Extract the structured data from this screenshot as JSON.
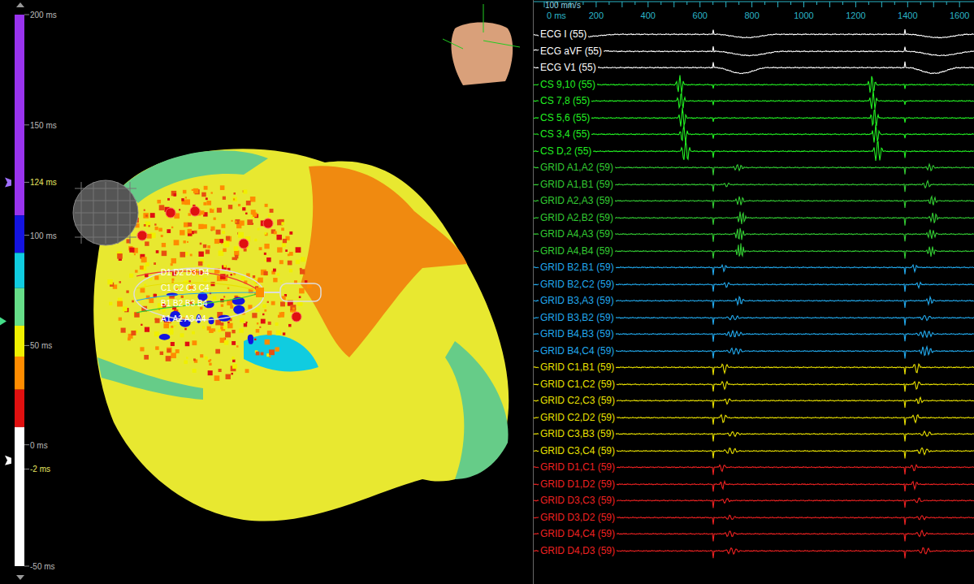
{
  "scale": {
    "labels": [
      {
        "text": "200 ms",
        "ms": 200,
        "highlight": false
      },
      {
        "text": "150 ms",
        "ms": 150,
        "highlight": false
      },
      {
        "text": "124 ms",
        "ms": 124,
        "highlight": true
      },
      {
        "text": "100 ms",
        "ms": 100,
        "highlight": false
      },
      {
        "text": "50 ms",
        "ms": 50,
        "highlight": false
      },
      {
        "text": "0 ms",
        "ms": 5,
        "highlight": false
      },
      {
        "text": "-2 ms",
        "ms": -6,
        "highlight": true
      },
      {
        "text": "-50 ms",
        "ms": -50,
        "highlight": false
      }
    ],
    "segments": [
      {
        "from_ms": 200,
        "to_ms": 109,
        "color": "#9933ee"
      },
      {
        "from_ms": 109,
        "to_ms": 92,
        "color": "#1414e0"
      },
      {
        "from_ms": 92,
        "to_ms": 76,
        "color": "#10cce0"
      },
      {
        "from_ms": 76,
        "to_ms": 59,
        "color": "#66dd88"
      },
      {
        "from_ms": 59,
        "to_ms": 45,
        "color": "#f0f000"
      },
      {
        "from_ms": 45,
        "to_ms": 30,
        "color": "#ff8c00"
      },
      {
        "from_ms": 30,
        "to_ms": 13,
        "color": "#e01010"
      },
      {
        "from_ms": 13,
        "to_ms": -50,
        "color": "#ffffff"
      }
    ],
    "markers": [
      {
        "ms": 124,
        "color": "#a070ff"
      },
      {
        "ms": 61,
        "color": "#44dd88"
      },
      {
        "ms": -2,
        "color": "#ffffff"
      }
    ]
  },
  "map": {
    "catheter_labels": [
      "D1 D2 D3 D4",
      "C1 C2 C3 C4",
      "B1 B2 B3 B4",
      "A1 A2 A3 A4"
    ]
  },
  "trace_panel": {
    "speed": "100 mm/s",
    "ticks": [
      "0 ms",
      "200",
      "400",
      "600",
      "800",
      "1000",
      "1200",
      "1400",
      "1600"
    ],
    "stimulus_ms": [
      650,
      1390
    ],
    "channels": [
      {
        "name": "ECG I (55)",
        "color": "#ffffff",
        "stim_amp": 6,
        "deflections": [
          {
            "t": -100,
            "amp": -4,
            "dur": 400,
            "cycles": 0.5
          },
          {
            "t": 660,
            "amp": -4,
            "dur": 240,
            "cycles": 0.5
          },
          {
            "t": 1400,
            "amp": -4,
            "dur": 240,
            "cycles": 0.5
          }
        ]
      },
      {
        "name": "ECG aVF (55)",
        "color": "#ffffff",
        "stim_amp": 6,
        "deflections": [
          {
            "t": -150,
            "amp": 3,
            "dur": 450,
            "cycles": 0.5
          },
          {
            "t": 660,
            "amp": -5,
            "dur": 260,
            "cycles": 0.5
          },
          {
            "t": 1400,
            "amp": -5,
            "dur": 260,
            "cycles": 0.5
          }
        ]
      },
      {
        "name": "ECG V1 (55)",
        "color": "#ffffff",
        "stim_amp": 7,
        "deflections": [
          {
            "t": 660,
            "amp": -7,
            "dur": 200,
            "cycles": 0.5
          },
          {
            "t": 1400,
            "amp": -7,
            "dur": 200,
            "cycles": 0.5
          }
        ]
      },
      {
        "name": "CS 9,10 (55)",
        "color": "#22ee22",
        "stim_amp": -5,
        "deflections": [
          {
            "t": 505,
            "amp": 12,
            "dur": 35,
            "cycles": 2.5
          },
          {
            "t": 1245,
            "amp": 12,
            "dur": 35,
            "cycles": 2.5
          }
        ]
      },
      {
        "name": "CS 7,8 (55)",
        "color": "#22ee22",
        "stim_amp": -5,
        "deflections": [
          {
            "t": 510,
            "amp": 12,
            "dur": 35,
            "cycles": 2.5
          },
          {
            "t": 1250,
            "amp": 12,
            "dur": 35,
            "cycles": 2.5
          }
        ]
      },
      {
        "name": "CS 5,6 (55)",
        "color": "#22ee22",
        "stim_amp": -5,
        "deflections": [
          {
            "t": 515,
            "amp": 13,
            "dur": 35,
            "cycles": 2.5
          },
          {
            "t": 1255,
            "amp": 13,
            "dur": 35,
            "cycles": 2.5
          }
        ]
      },
      {
        "name": "CS 3,4 (55)",
        "color": "#22ee22",
        "stim_amp": -5,
        "deflections": [
          {
            "t": 520,
            "amp": 12,
            "dur": 35,
            "cycles": 2.5
          },
          {
            "t": 1260,
            "amp": 12,
            "dur": 35,
            "cycles": 2.5
          }
        ]
      },
      {
        "name": "CS D,2 (55)",
        "color": "#22ee22",
        "stim_amp": -8,
        "deflections": [
          {
            "t": 525,
            "amp": 14,
            "dur": 40,
            "cycles": 2.5
          },
          {
            "t": 1265,
            "amp": 14,
            "dur": 40,
            "cycles": 2.5
          }
        ]
      },
      {
        "name": "GRID A1,A2 (59)",
        "color": "#33cc33",
        "stim_amp": -9,
        "deflections": [
          {
            "t": 725,
            "amp": 4,
            "dur": 45,
            "cycles": 3
          },
          {
            "t": 1465,
            "amp": 4,
            "dur": 45,
            "cycles": 3
          }
        ]
      },
      {
        "name": "GRID A1,B1 (59)",
        "color": "#33cc33",
        "stim_amp": -9,
        "deflections": [
          {
            "t": 690,
            "amp": 3,
            "dur": 25,
            "cycles": 1.5
          },
          {
            "t": 1455,
            "amp": 5,
            "dur": 35,
            "cycles": 2
          }
        ]
      },
      {
        "name": "GRID A2,A3 (59)",
        "color": "#33cc33",
        "stim_amp": -9,
        "deflections": [
          {
            "t": 735,
            "amp": 6,
            "dur": 40,
            "cycles": 3
          },
          {
            "t": 1475,
            "amp": 6,
            "dur": 40,
            "cycles": 3
          }
        ]
      },
      {
        "name": "GRID A2,B2 (59)",
        "color": "#33cc33",
        "stim_amp": -9,
        "deflections": [
          {
            "t": 740,
            "amp": 8,
            "dur": 40,
            "cycles": 3.5
          },
          {
            "t": 1480,
            "amp": 7,
            "dur": 40,
            "cycles": 3
          }
        ]
      },
      {
        "name": "GRID A4,A3 (59)",
        "color": "#33cc33",
        "stim_amp": -9,
        "deflections": [
          {
            "t": 730,
            "amp": 9,
            "dur": 45,
            "cycles": 4
          },
          {
            "t": 1470,
            "amp": 6,
            "dur": 45,
            "cycles": 3.5
          }
        ]
      },
      {
        "name": "GRID A4,B4 (59)",
        "color": "#33cc33",
        "stim_amp": -9,
        "deflections": [
          {
            "t": 735,
            "amp": 10,
            "dur": 40,
            "cycles": 4
          },
          {
            "t": 1470,
            "amp": 7,
            "dur": 40,
            "cycles": 3.5
          }
        ]
      },
      {
        "name": "GRID B2,B1 (59)",
        "color": "#22aaee",
        "stim_amp": -9,
        "deflections": [
          {
            "t": 680,
            "amp": 5,
            "dur": 25,
            "cycles": 1.5
          },
          {
            "t": 1415,
            "amp": 5,
            "dur": 25,
            "cycles": 1.5
          }
        ]
      },
      {
        "name": "GRID B2,C2 (59)",
        "color": "#22aaee",
        "stim_amp": -9,
        "deflections": [
          {
            "t": 690,
            "amp": 4,
            "dur": 25,
            "cycles": 1.5
          },
          {
            "t": 1430,
            "amp": 4,
            "dur": 25,
            "cycles": 1.5
          }
        ]
      },
      {
        "name": "GRID B3,A3 (59)",
        "color": "#22aaee",
        "stim_amp": -9,
        "deflections": [
          {
            "t": 735,
            "amp": 6,
            "dur": 35,
            "cycles": 2.5
          },
          {
            "t": 1470,
            "amp": 5,
            "dur": 35,
            "cycles": 2.5
          }
        ]
      },
      {
        "name": "GRID B3,B2 (59)",
        "color": "#22aaee",
        "stim_amp": -9,
        "deflections": [
          {
            "t": 700,
            "amp": 3,
            "dur": 60,
            "cycles": 3
          },
          {
            "t": 1440,
            "amp": 3,
            "dur": 60,
            "cycles": 3
          }
        ]
      },
      {
        "name": "GRID B4,B3 (59)",
        "color": "#22aaee",
        "stim_amp": -9,
        "deflections": [
          {
            "t": 690,
            "amp": 4,
            "dur": 80,
            "cycles": 5
          },
          {
            "t": 1430,
            "amp": 4,
            "dur": 80,
            "cycles": 5
          }
        ]
      },
      {
        "name": "GRID B4,C4 (59)",
        "color": "#22aaee",
        "stim_amp": -9,
        "deflections": [
          {
            "t": 700,
            "amp": 4,
            "dur": 70,
            "cycles": 4
          },
          {
            "t": 1440,
            "amp": 6,
            "dur": 60,
            "cycles": 4
          }
        ]
      },
      {
        "name": "GRID C1,B1 (59)",
        "color": "#e8e000",
        "stim_amp": -9,
        "deflections": [
          {
            "t": 680,
            "amp": 7,
            "dur": 30,
            "cycles": 1.5
          },
          {
            "t": 1420,
            "amp": 7,
            "dur": 30,
            "cycles": 1.5
          }
        ]
      },
      {
        "name": "GRID C1,C2 (59)",
        "color": "#e8e000",
        "stim_amp": -9,
        "deflections": [
          {
            "t": 680,
            "amp": 6,
            "dur": 30,
            "cycles": 1.5
          },
          {
            "t": 1420,
            "amp": 6,
            "dur": 30,
            "cycles": 1.5
          }
        ]
      },
      {
        "name": "GRID C2,C3 (59)",
        "color": "#e8e000",
        "stim_amp": -9,
        "deflections": [
          {
            "t": 690,
            "amp": 4,
            "dur": 30,
            "cycles": 1.5
          },
          {
            "t": 1430,
            "amp": 5,
            "dur": 30,
            "cycles": 2
          }
        ]
      },
      {
        "name": "GRID C2,D2 (59)",
        "color": "#e8e000",
        "stim_amp": -9,
        "deflections": [
          {
            "t": 675,
            "amp": 6,
            "dur": 30,
            "cycles": 1.5
          },
          {
            "t": 1415,
            "amp": 6,
            "dur": 30,
            "cycles": 1.5
          }
        ]
      },
      {
        "name": "GRID C3,B3 (59)",
        "color": "#e8e000",
        "stim_amp": -9,
        "deflections": [
          {
            "t": 700,
            "amp": 3,
            "dur": 60,
            "cycles": 3
          },
          {
            "t": 1440,
            "amp": 3,
            "dur": 60,
            "cycles": 3
          }
        ]
      },
      {
        "name": "GRID C3,C4 (59)",
        "color": "#e8e000",
        "stim_amp": -9,
        "deflections": [
          {
            "t": 690,
            "amp": 4,
            "dur": 60,
            "cycles": 3
          },
          {
            "t": 1430,
            "amp": 4,
            "dur": 60,
            "cycles": 3
          }
        ]
      },
      {
        "name": "GRID D1,C1 (59)",
        "color": "#ee2222",
        "stim_amp": -9,
        "deflections": [
          {
            "t": 670,
            "amp": 5,
            "dur": 30,
            "cycles": 1.5
          },
          {
            "t": 1410,
            "amp": 5,
            "dur": 30,
            "cycles": 1.5
          }
        ]
      },
      {
        "name": "GRID D1,D2 (59)",
        "color": "#ee2222",
        "stim_amp": -9,
        "deflections": [
          {
            "t": 675,
            "amp": 6,
            "dur": 25,
            "cycles": 1.5
          },
          {
            "t": 1415,
            "amp": 6,
            "dur": 25,
            "cycles": 1.5
          }
        ]
      },
      {
        "name": "GRID D3,C3 (59)",
        "color": "#ee2222",
        "stim_amp": -9,
        "deflections": [
          {
            "t": 680,
            "amp": 3,
            "dur": 40,
            "cycles": 2
          },
          {
            "t": 1420,
            "amp": 3,
            "dur": 40,
            "cycles": 2
          }
        ]
      },
      {
        "name": "GRID D3,D2 (59)",
        "color": "#ee2222",
        "stim_amp": -9,
        "deflections": [
          {
            "t": 690,
            "amp": 3,
            "dur": 50,
            "cycles": 2.5
          },
          {
            "t": 1430,
            "amp": 3,
            "dur": 50,
            "cycles": 2.5
          }
        ]
      },
      {
        "name": "GRID D4,C4 (59)",
        "color": "#ee2222",
        "stim_amp": -9,
        "deflections": [
          {
            "t": 690,
            "amp": 4,
            "dur": 50,
            "cycles": 2.5
          },
          {
            "t": 1430,
            "amp": 4,
            "dur": 50,
            "cycles": 2.5
          }
        ]
      },
      {
        "name": "GRID D4,D3 (59)",
        "color": "#ee2222",
        "stim_amp": -9,
        "deflections": [
          {
            "t": 695,
            "amp": 4,
            "dur": 60,
            "cycles": 3
          },
          {
            "t": 1435,
            "amp": 4,
            "dur": 60,
            "cycles": 3
          }
        ]
      }
    ]
  }
}
